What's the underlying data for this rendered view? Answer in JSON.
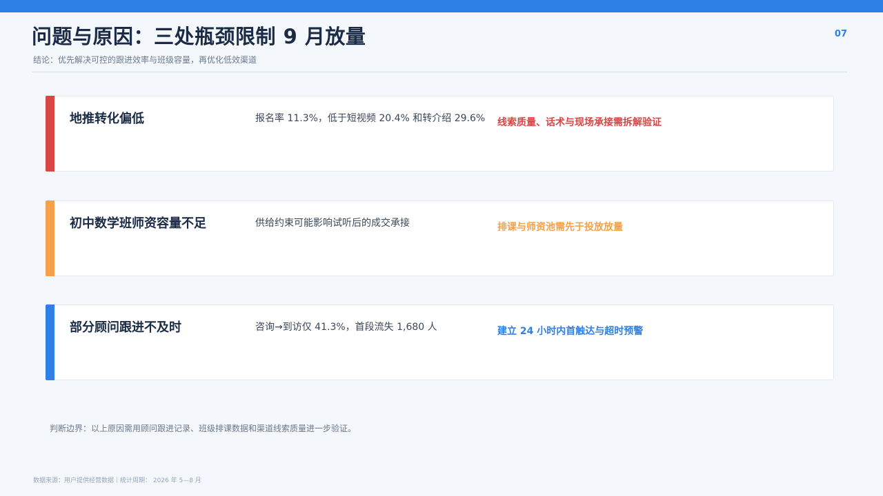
{
  "header": {
    "title": "问题与原因：三处瓶颈限制 9 月放量",
    "page_number": "07",
    "subtitle": "结论：优先解决可控的跟进效率与班级容量，再优化低效渠道"
  },
  "colors": {
    "brand": "#2f80e6",
    "red": "#d94646",
    "orange": "#f5a04a",
    "blue": "#2f80e6"
  },
  "issues": [
    {
      "title": "地推转化偏低",
      "description": "报名率 11.3%，低于短视频 20.4% 和转介绍 29.6%",
      "action": "线索质量、话术与现场承接需拆解验证",
      "color": "#d94646"
    },
    {
      "title": "初中数学班师资容量不足",
      "description": "供给约束可能影响试听后的成交承接",
      "action": "排课与师资池需先于投放放量",
      "color": "#f5a04a"
    },
    {
      "title": "部分顾问跟进不及时",
      "description": "咨询→到访仅 41.3%，首段流失 1,680 人",
      "action": "建立 24 小时内首触达与超时预警",
      "color": "#2f80e6"
    }
  ],
  "footer": {
    "note": "判断边界：以上原因需用顾问跟进记录、班级排课数据和渠道线索质量进一步验证。",
    "source": "数据来源：用户提供经营数据｜统计周期： 2026 年 5—8 月"
  }
}
